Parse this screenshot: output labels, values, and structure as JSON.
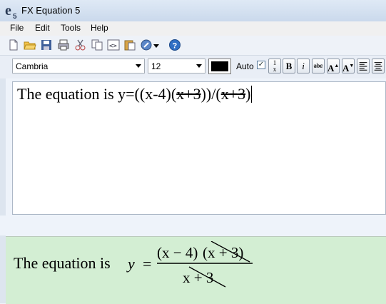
{
  "window": {
    "title": "FX Equation 5"
  },
  "menu": [
    "File",
    "Edit",
    "Tools",
    "Help"
  ],
  "toolbar": {
    "icons": [
      "new-doc-icon",
      "open-folder-icon",
      "save-icon",
      "print-icon",
      "cut-icon",
      "copy-icon",
      "code-icon",
      "paste-icon",
      "plugin-icon",
      "dropdown-arrow-icon",
      "help-icon"
    ]
  },
  "format": {
    "font": "Cambria",
    "size": "12",
    "auto_label": "Auto",
    "auto_checked": true,
    "color": "#000000"
  },
  "editor": {
    "text_plain": "The equation is y=((x-4)(",
    "text_strike1": "x+3",
    "text_mid": "))/(",
    "text_strike2": "x+3",
    "text_end": ")"
  },
  "preview": {
    "lead": "The equation is ",
    "var_y": "y",
    "equals": "=",
    "numerator_left": "(x − 4)",
    "numerator_right": "(x + 3)",
    "denominator": "x + 3"
  }
}
